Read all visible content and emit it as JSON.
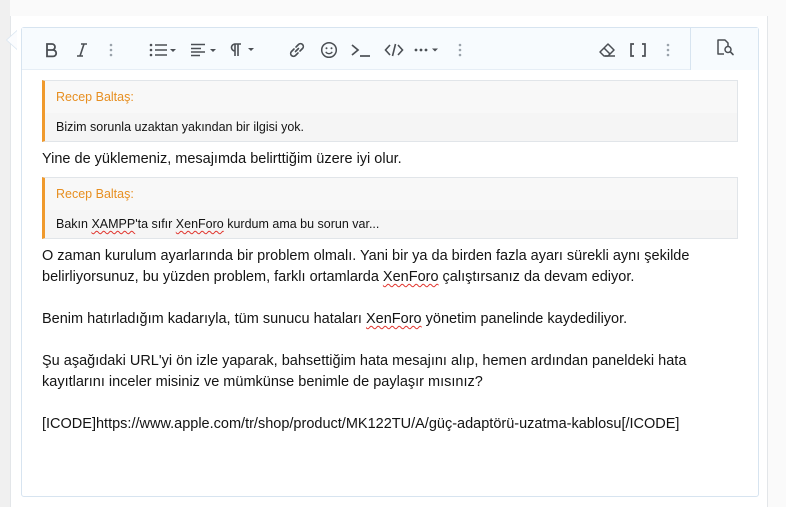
{
  "toolbar": {
    "buttons": [
      {
        "name": "bold-button",
        "icon": "bold-icon"
      },
      {
        "name": "italic-button",
        "icon": "italic-icon"
      },
      {
        "name": "more-text-options-button",
        "icon": "more-vertical-icon"
      },
      {
        "name": "list-button",
        "icon": "list-icon"
      },
      {
        "name": "align-button",
        "icon": "align-left-icon"
      },
      {
        "name": "paragraph-button",
        "icon": "paragraph-icon"
      },
      {
        "name": "link-button",
        "icon": "link-icon"
      },
      {
        "name": "smilie-button",
        "icon": "smile-icon"
      },
      {
        "name": "code-button",
        "icon": "terminal-icon"
      },
      {
        "name": "inline-code-button",
        "icon": "code-icon"
      },
      {
        "name": "insert-more-button",
        "icon": "more-horizontal-icon"
      },
      {
        "name": "more-options-button",
        "icon": "more-vertical-icon"
      },
      {
        "name": "remove-format-button",
        "icon": "eraser-icon"
      },
      {
        "name": "toggle-bbcode-button",
        "icon": "brackets-icon"
      },
      {
        "name": "more-options-right-button",
        "icon": "more-vertical-icon"
      },
      {
        "name": "preview-button",
        "icon": "preview-search-icon"
      }
    ]
  },
  "content": {
    "quote1": {
      "author": "Recep Baltaş:",
      "body": "Bizim sorunla uzaktan yakından bir ilgisi yok."
    },
    "reply1": "Yine de yüklemeniz, mesajımda belirttiğim üzere iyi olur.",
    "quote2": {
      "author": "Recep Baltaş:",
      "body_before": "Bakın ",
      "body_xampp": "XAMPP",
      "body_mid": "'ta sıfır ",
      "body_xenforo": "XenForo",
      "body_after": " kurdum ama bu sorun var..."
    },
    "para1": {
      "line1": "O zaman kurulum ayarlarında bir problem olmalı. Yani bir ya da birden fazla ayarı sürekli aynı şekilde",
      "line2_before": "belirliyorsunuz, bu yüzden problem, farklı ortamlarda ",
      "line2_xenforo": "XenForo",
      "line2_after": " çalıştırsanız da devam ediyor."
    },
    "para2": {
      "before": "Benim hatırladığım kadarıyla, tüm sunucu hataları ",
      "xenforo": "XenForo",
      "after": " yönetim panelinde kaydediliyor."
    },
    "para3": {
      "line1": "Şu aşağıdaki URL'yi ön izle yaparak, bahsettiğim hata mesajını alıp, hemen ardından paneldeki hata",
      "line2": "kayıtlarını inceler misiniz ve mümkünse benimle de paylaşır mısınız?"
    },
    "para4": "[ICODE]https://www.apple.com/tr/shop/product/MK122TU/A/güç-adaptörü-uzatma-kablosu[/ICODE]"
  },
  "colors": {
    "quote_accent": "#f09a2d",
    "quote_author": "#e78f21",
    "border": "#d7e4f0",
    "spellcheck": "#e0332c"
  }
}
